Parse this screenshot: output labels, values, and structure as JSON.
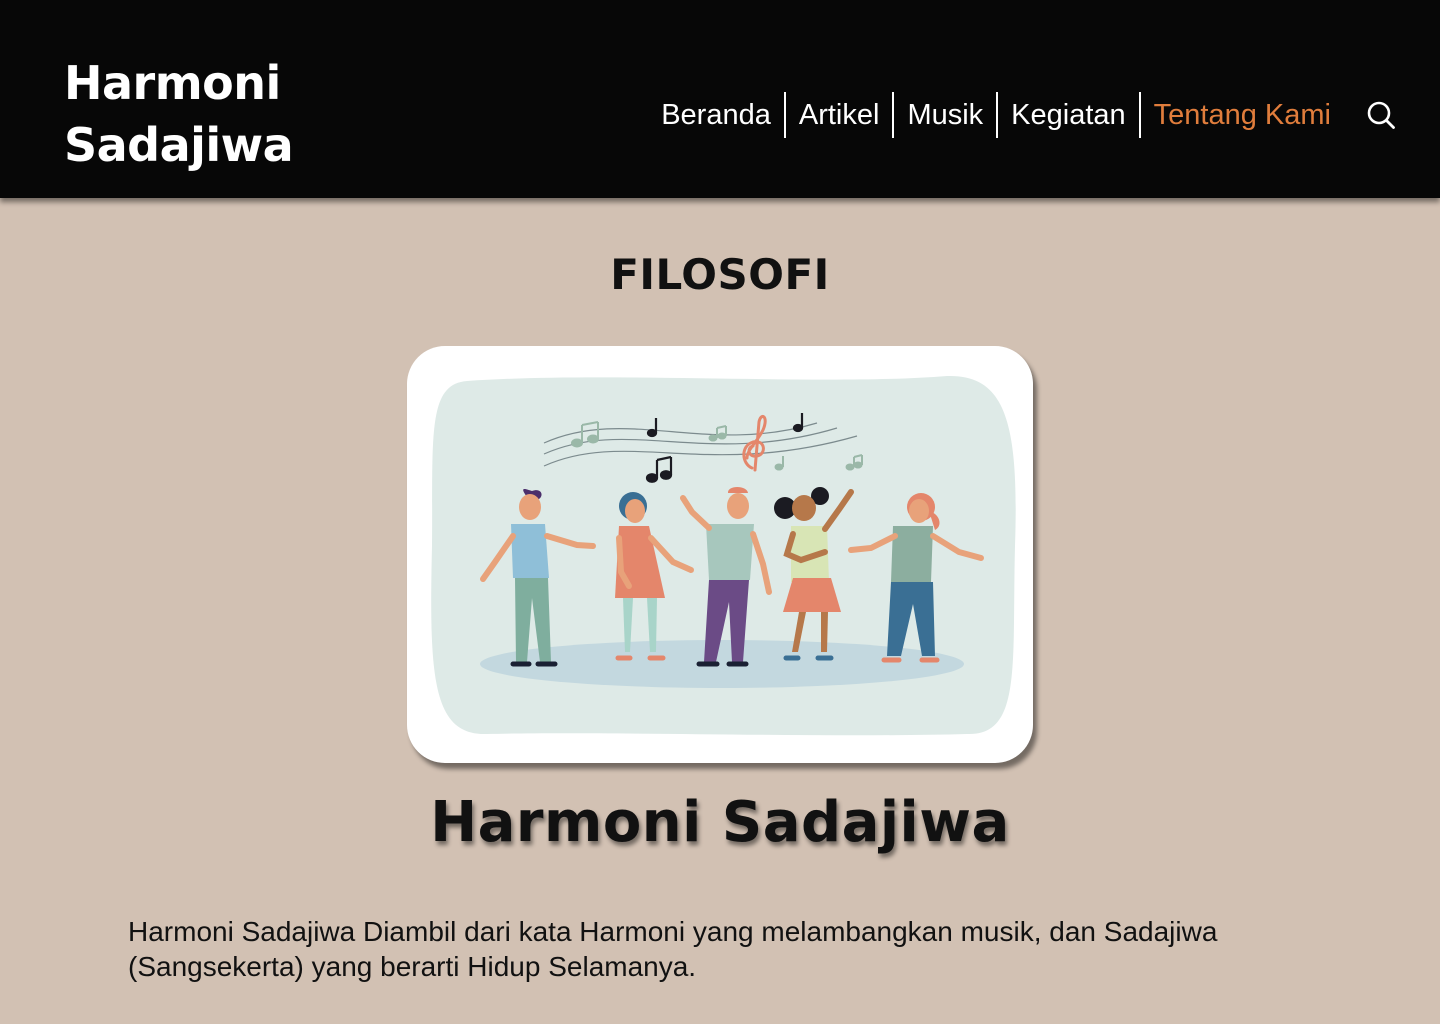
{
  "brand": {
    "line1": "Harmoni",
    "line2": "Sadajiwa"
  },
  "nav": {
    "items": [
      {
        "label": "Beranda",
        "active": false
      },
      {
        "label": "Artikel",
        "active": false
      },
      {
        "label": "Musik",
        "active": false
      },
      {
        "label": "Kegiatan",
        "active": false
      },
      {
        "label": "Tentang Kami",
        "active": true
      }
    ],
    "search_icon": "search-icon"
  },
  "section": {
    "title": "FILOSOFI"
  },
  "illustration": {
    "icon": "people-singing-illustration"
  },
  "about": {
    "name": "Harmoni Sadajiwa",
    "description": "Harmoni Sadajiwa Diambil dari kata Harmoni yang melambangkan musik, dan Sadajiwa (Sangsekerta) yang berarti Hidup Selamanya."
  },
  "colors": {
    "background": "#d2c1b3",
    "navbar": "#070707",
    "active_link": "#e07d3c",
    "text": "#111111"
  }
}
